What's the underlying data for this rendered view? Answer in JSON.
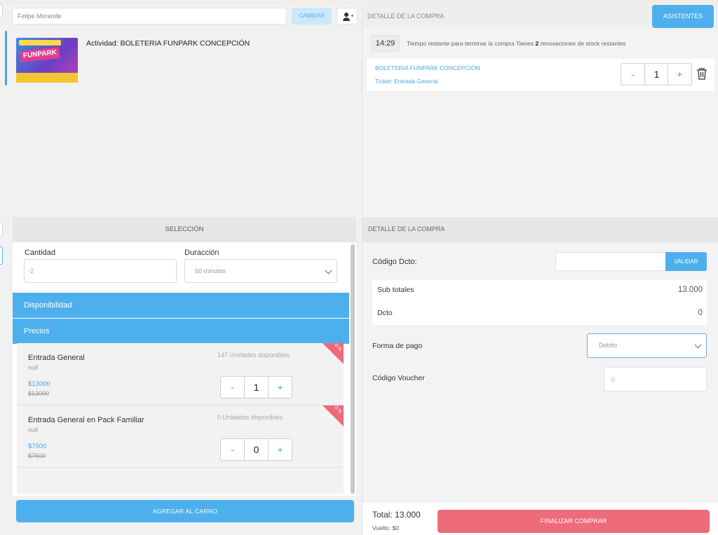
{
  "user": {
    "name_value": "Felipe Morande",
    "change_label": "CAMBIAR",
    "icon": "user-plus-icon"
  },
  "activity": {
    "title": "Actividad: BOLETERIA FUNPARK CONCEPCIÓN",
    "thumbnail_logo": "FUNPARK"
  },
  "seleccion": {
    "header": "SELECCIÓN",
    "cantidad_label": "Cantidad",
    "cantidad_value": "-2",
    "duracion_label": "Duracción",
    "duracion_value": "60 minutos",
    "disponibilidad_label": "Disponibilidad",
    "precios_label": "Precios",
    "items": [
      {
        "name": "Entrada General",
        "sub": "null",
        "price": "$13000",
        "old_price": "$13000",
        "availability": "147 Unidades disponibles",
        "discount": "0 %",
        "qty": "1",
        "minus": "-",
        "plus": "+"
      },
      {
        "name": "Entrada General en Pack Familiar",
        "sub": "null",
        "price": "$7500",
        "old_price": "$7500",
        "availability": "0 Unidades disponibles",
        "discount": "0 %",
        "qty": "0",
        "minus": "-",
        "plus": "+"
      }
    ],
    "add_to_cart_label": "AGREGAR AL CARRO"
  },
  "detalle": {
    "header": "DETALLE DE LA COMPRA",
    "asistentes_label": "ASISTENTES",
    "timer": "14:29",
    "timer_text_a": "Tiempo restante para terminar la compra Tienes",
    "timer_renovaciones": "2",
    "timer_text_b": "renovaciones de stock restantes",
    "cart_item_name": "BOLETERIA FUNPARK CONCEPCIÓN",
    "cart_item_ticket": "Ticket: Entrada General",
    "cart_item_qty": "1",
    "cart_minus": "-",
    "cart_plus": "+"
  },
  "compra": {
    "header": "DETALLE DE LA COMPRA",
    "codigo_label": "Código Dcto:",
    "validar_label": "VALIDAR",
    "subtotales_label": "Sub totales",
    "subtotales_value": "13.000",
    "dcto_label": "Dcto",
    "dcto_value": "0",
    "forma_pago_label": "Forma de pago",
    "forma_pago_value": "Debito",
    "voucher_label": "Código Voucher",
    "voucher_value": "0"
  },
  "footer": {
    "total_label": "Total:",
    "total_value": "13.000",
    "vuelto_label": "Vuelto:",
    "vuelto_value": "$0",
    "finalizar_label": "FINALIZAR COMPRAR"
  },
  "colors": {
    "accent_blue": "#4db0ec",
    "finalize_red": "#ee6b7b",
    "link_blue": "#4aa6e3"
  }
}
